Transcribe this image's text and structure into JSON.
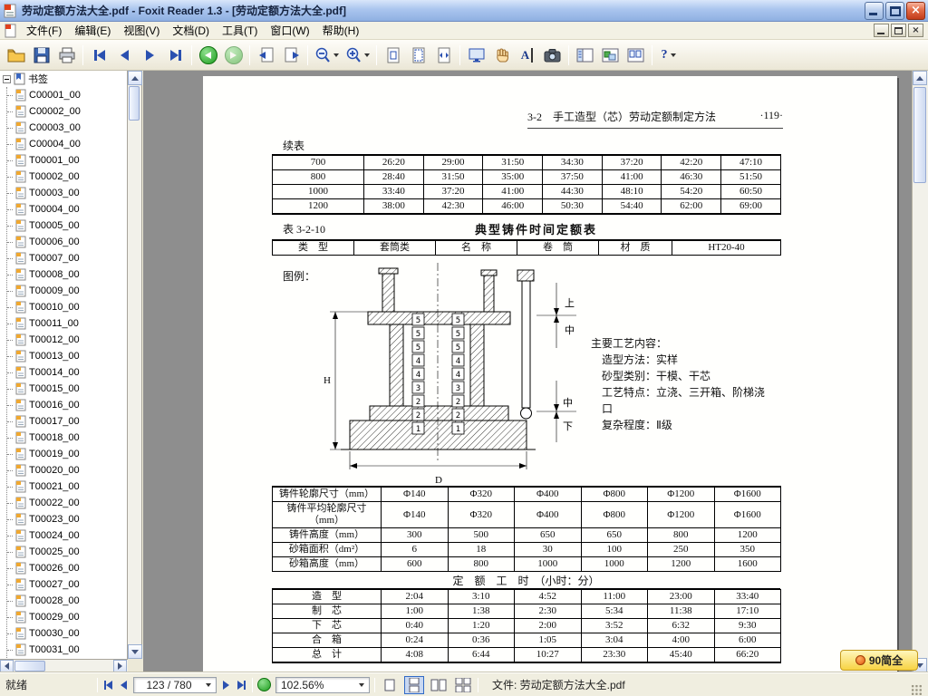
{
  "window": {
    "title": "劳动定额方法大全.pdf - Foxit Reader 1.3 - [劳动定额方法大全.pdf]"
  },
  "menubar": {
    "items": [
      "文件(F)",
      "编辑(E)",
      "视图(V)",
      "文档(D)",
      "工具(T)",
      "窗口(W)",
      "帮助(H)"
    ]
  },
  "toolbar": {
    "buttons": [
      "open",
      "save",
      "print",
      "first-page",
      "previous-page",
      "next-page",
      "last-page",
      "go-back",
      "go-forward",
      "previous-view",
      "next-view",
      "zoom-out",
      "zoom-in",
      "actual-size",
      "fit-page",
      "fit-width",
      "full-screen",
      "hand-tool",
      "select-text",
      "snapshot",
      "bookmarks-panel",
      "layers-panel",
      "pages-panel",
      "help"
    ]
  },
  "bookmarks": {
    "root": "书签",
    "items": [
      "C00001_00",
      "C00002_00",
      "C00003_00",
      "C00004_00",
      "T00001_00",
      "T00002_00",
      "T00003_00",
      "T00004_00",
      "T00005_00",
      "T00006_00",
      "T00007_00",
      "T00008_00",
      "T00009_00",
      "T00010_00",
      "T00011_00",
      "T00012_00",
      "T00013_00",
      "T00014_00",
      "T00015_00",
      "T00016_00",
      "T00017_00",
      "T00018_00",
      "T00019_00",
      "T00020_00",
      "T00021_00",
      "T00022_00",
      "T00023_00",
      "T00024_00",
      "T00025_00",
      "T00026_00",
      "T00027_00",
      "T00028_00",
      "T00029_00",
      "T00030_00",
      "T00031_00"
    ]
  },
  "page": {
    "header": {
      "section": "3-2　手工造型（芯）劳动定额制定方法",
      "folio": "·119·"
    },
    "cont_label": "续表",
    "cont_table": {
      "rows": [
        [
          "700",
          "26:20",
          "29:00",
          "31:50",
          "34:30",
          "37:20",
          "42:20",
          "47:10"
        ],
        [
          "800",
          "28:40",
          "31:50",
          "35:00",
          "37:50",
          "41:00",
          "46:30",
          "51:50"
        ],
        [
          "1000",
          "33:40",
          "37:20",
          "41:00",
          "44:30",
          "48:10",
          "54:20",
          "60:50"
        ],
        [
          "1200",
          "38:00",
          "42:30",
          "46:00",
          "50:30",
          "54:40",
          "62:00",
          "69:00"
        ]
      ]
    },
    "table_no": "表 3-2-10",
    "table_title": "典型铸件时间定额表",
    "type_table": {
      "rows": [
        [
          "类　型",
          "套筒类",
          "名　称",
          "卷　筒",
          "材　质",
          "HT20-40"
        ]
      ]
    },
    "legend_label": "图例：",
    "figure": {
      "dim_h": "H",
      "dim_d": "D",
      "sections": [
        "上",
        "中",
        "中",
        "下"
      ],
      "core_numbers": [
        "5",
        "5",
        "5",
        "4",
        "4",
        "3",
        "2",
        "2",
        "1"
      ]
    },
    "notes_title": "主要工艺内容：",
    "notes": [
      "造型方法：实样",
      "砂型类别：干模、干芯",
      "工艺特点：立浇、三开箱、阶梯浇口",
      "复杂程度：Ⅱ级"
    ],
    "dims_table": {
      "rows": [
        [
          "铸件轮廓尺寸（mm）",
          "Φ140",
          "Φ320",
          "Φ400",
          "Φ800",
          "Φ1200",
          "Φ1600"
        ],
        [
          "铸件平均轮廓尺寸（mm）",
          "Φ140",
          "Φ320",
          "Φ400",
          "Φ800",
          "Φ1200",
          "Φ1600"
        ],
        [
          "铸件高度（mm）",
          "300",
          "500",
          "650",
          "650",
          "800",
          "1200"
        ],
        [
          "砂箱面积（dm²）",
          "6",
          "18",
          "30",
          "100",
          "250",
          "350"
        ],
        [
          "砂箱高度（mm）",
          "600",
          "800",
          "1000",
          "1000",
          "1200",
          "1600"
        ]
      ]
    },
    "time_band": "定　额　工　时　（小时：分）",
    "time_table": {
      "rows": [
        [
          "造　型",
          "2:04",
          "3:10",
          "4:52",
          "11:00",
          "23:00",
          "33:40"
        ],
        [
          "制　芯",
          "1:00",
          "1:38",
          "2:30",
          "5:34",
          "11:38",
          "17:10"
        ],
        [
          "下　芯",
          "0:40",
          "1:20",
          "2:00",
          "3:52",
          "6:32",
          "9:30"
        ],
        [
          "合　箱",
          "0:24",
          "0:36",
          "1:05",
          "3:04",
          "4:00",
          "6:00"
        ],
        [
          "总　计",
          "4:08",
          "6:44",
          "10:27",
          "23:30",
          "45:40",
          "66:20"
        ]
      ]
    }
  },
  "statusbar": {
    "ready": "就绪",
    "page_display": "123 / 780",
    "zoom": "102.56%",
    "file_label": "文件: 劳动定额方法大全.pdf"
  },
  "ime": {
    "text": "90简全"
  }
}
